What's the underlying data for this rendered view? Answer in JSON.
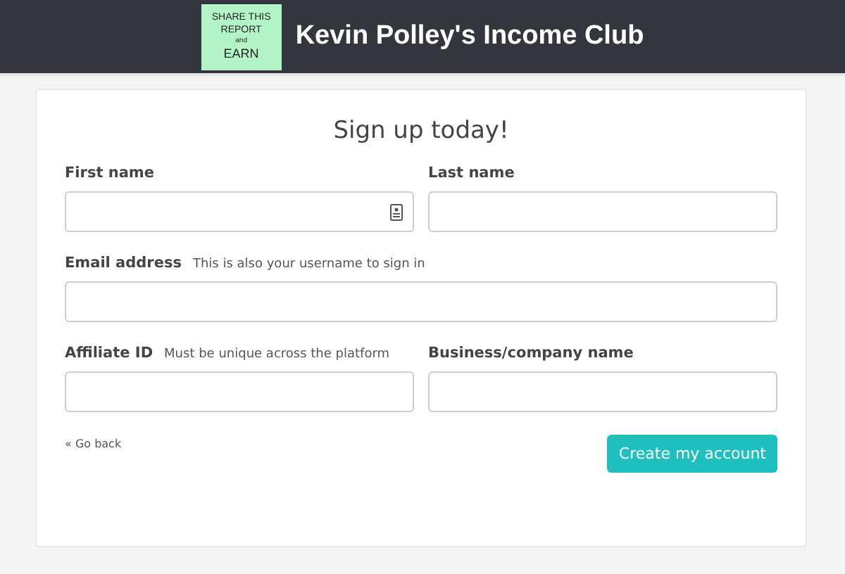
{
  "header": {
    "logo_lines": [
      "SHARE THIS",
      "REPORT",
      "and",
      "EARN"
    ],
    "title": "Kevin Polley's Income Club"
  },
  "form": {
    "heading": "Sign up today!",
    "rows": [
      [
        {
          "label": "First name",
          "autofill_icon": true
        },
        {
          "label": "Last name"
        }
      ],
      [
        {
          "label": "Email address",
          "hint": "This is also your username to sign in"
        }
      ],
      [
        {
          "label": "Affiliate ID",
          "hint": "Must be unique across the platform"
        },
        {
          "label": "Business/company name"
        }
      ]
    ],
    "back_link": "« Go back",
    "submit": "Create my account"
  }
}
